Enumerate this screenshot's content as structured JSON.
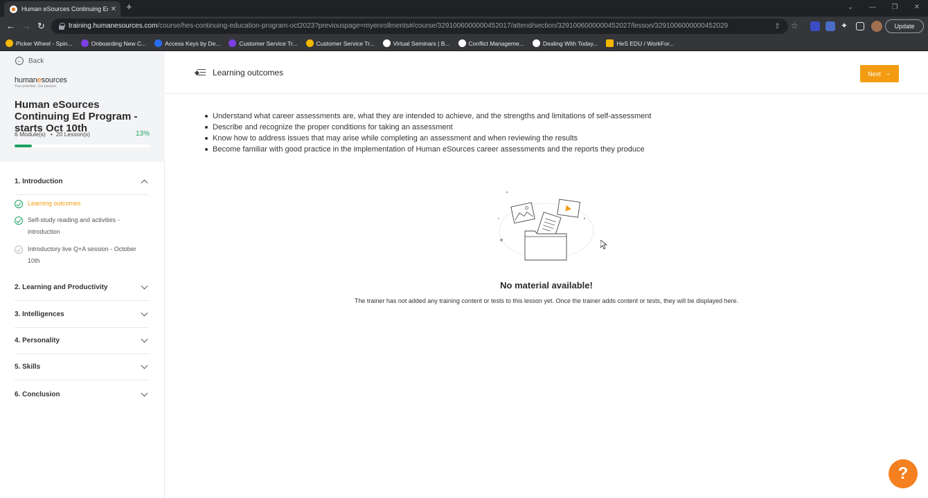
{
  "browser": {
    "tab_title": "Human eSources Continuing Edu",
    "url_host": "training.humanesources.com",
    "url_path": "/course/hes-continuing-education-program-oct2023?previouspage=myenrollments#/course/3291006000000452017/attend/section/3291006000000452027/lesson/3291006000000452029",
    "update_label": "Update",
    "ext_badge_1": "5",
    "ext_badge_2": "15",
    "bookmarks": [
      {
        "label": "Picker Wheel - Spin...",
        "color": "#f5b800"
      },
      {
        "label": "Onboarding New C...",
        "color": "#7b3fe4"
      },
      {
        "label": "Access Keys by De...",
        "color": "#2a6cf0"
      },
      {
        "label": "Customer Service Tr...",
        "color": "#7b3fe4"
      },
      {
        "label": "Customer Service Tr...",
        "color": "#f5b800"
      },
      {
        "label": "Virtual Seminars | B...",
        "color": "#ffffff"
      },
      {
        "label": "Conflict Manageme...",
        "color": "#ffffff"
      },
      {
        "label": "Dealing With Today...",
        "color": "#ffffff"
      },
      {
        "label": "HeS EDU / WorkFor...",
        "color": "#f5b800"
      }
    ]
  },
  "sidebar": {
    "back_label": "Back",
    "logo_text_a": "human",
    "logo_text_b": "e",
    "logo_text_c": "sources",
    "logo_tagline": "Your potential. Our passion.",
    "course_title": "Human eSources Continuing Ed Program - starts Oct 10th",
    "modules_count": "6 Module(s)",
    "lessons_count": "20 Lesson(s)",
    "progress_percent": "13%",
    "progress_value": 0.13,
    "modules": [
      {
        "label": "1. Introduction",
        "expanded": true
      },
      {
        "label": "2. Learning and Productivity",
        "expanded": false
      },
      {
        "label": "3. Intelligences",
        "expanded": false
      },
      {
        "label": "4. Personality",
        "expanded": false
      },
      {
        "label": "5. Skills",
        "expanded": false
      },
      {
        "label": "6. Conclusion",
        "expanded": false
      }
    ],
    "lessons": [
      {
        "label": "Learning outcomes",
        "status": "active"
      },
      {
        "label": "Self-study reading and activities - introduction",
        "status": "done"
      },
      {
        "label": "Introductory live Q+A session - October 10th",
        "status": "pending"
      }
    ]
  },
  "main": {
    "lesson_title": "Learning outcomes",
    "next_label": "Next",
    "outcomes": [
      "Understand what career assessments are, what they are intended to achieve, and the strengths and limitations of self-assessment",
      "Describe and recognize the proper conditions for taking an assessment",
      "Know how to address issues that may arise while completing an assessment and when reviewing the results",
      "Become familiar with good practice in the implementation of Human eSources career assessments and the reports they produce"
    ],
    "empty_title": "No material available!",
    "empty_desc": "The trainer has not added any training content or tests to this lesson yet. Once the trainer adds content or tests, they will be displayed here.",
    "help_label": "?"
  },
  "colors": {
    "accent": "#f39c12",
    "success": "#1aa260",
    "help": "#f4801f"
  }
}
